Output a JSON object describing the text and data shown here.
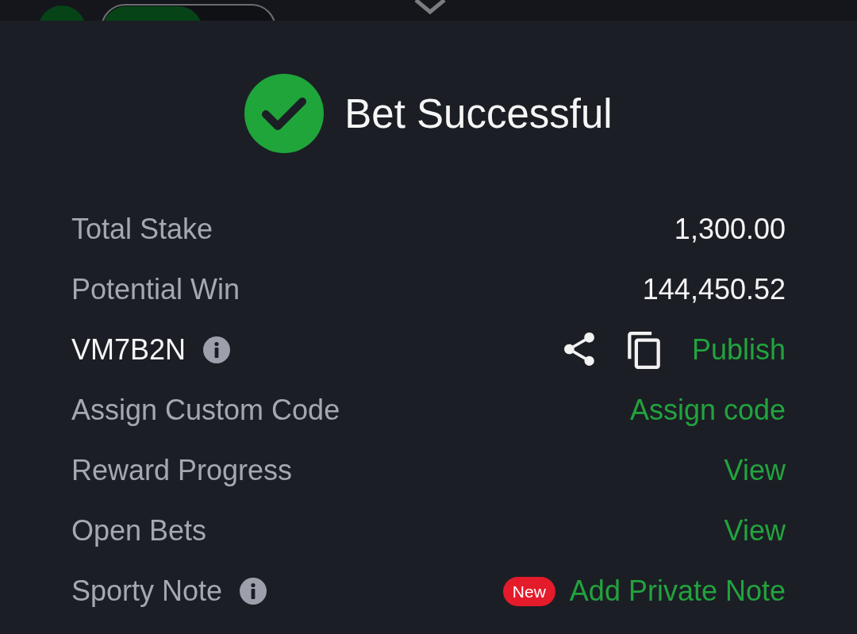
{
  "top_bar": {
    "toggle": {
      "on": true
    }
  },
  "header": {
    "title": "Bet Successful"
  },
  "rows": [
    {
      "kind": "value",
      "label": "Total Stake",
      "value": "1,300.00"
    },
    {
      "kind": "value",
      "label": "Potential Win",
      "value": "144,450.52"
    },
    {
      "kind": "code",
      "label": "VM7B2N",
      "info": true,
      "action": "Publish"
    },
    {
      "kind": "link",
      "label": "Assign Custom Code",
      "action": "Assign code"
    },
    {
      "kind": "link",
      "label": "Reward Progress",
      "action": "View"
    },
    {
      "kind": "link",
      "label": "Open Bets",
      "action": "View"
    },
    {
      "kind": "note",
      "label": "Sporty Note",
      "info": true,
      "badge": "New",
      "action": "Add Private Note"
    }
  ]
}
